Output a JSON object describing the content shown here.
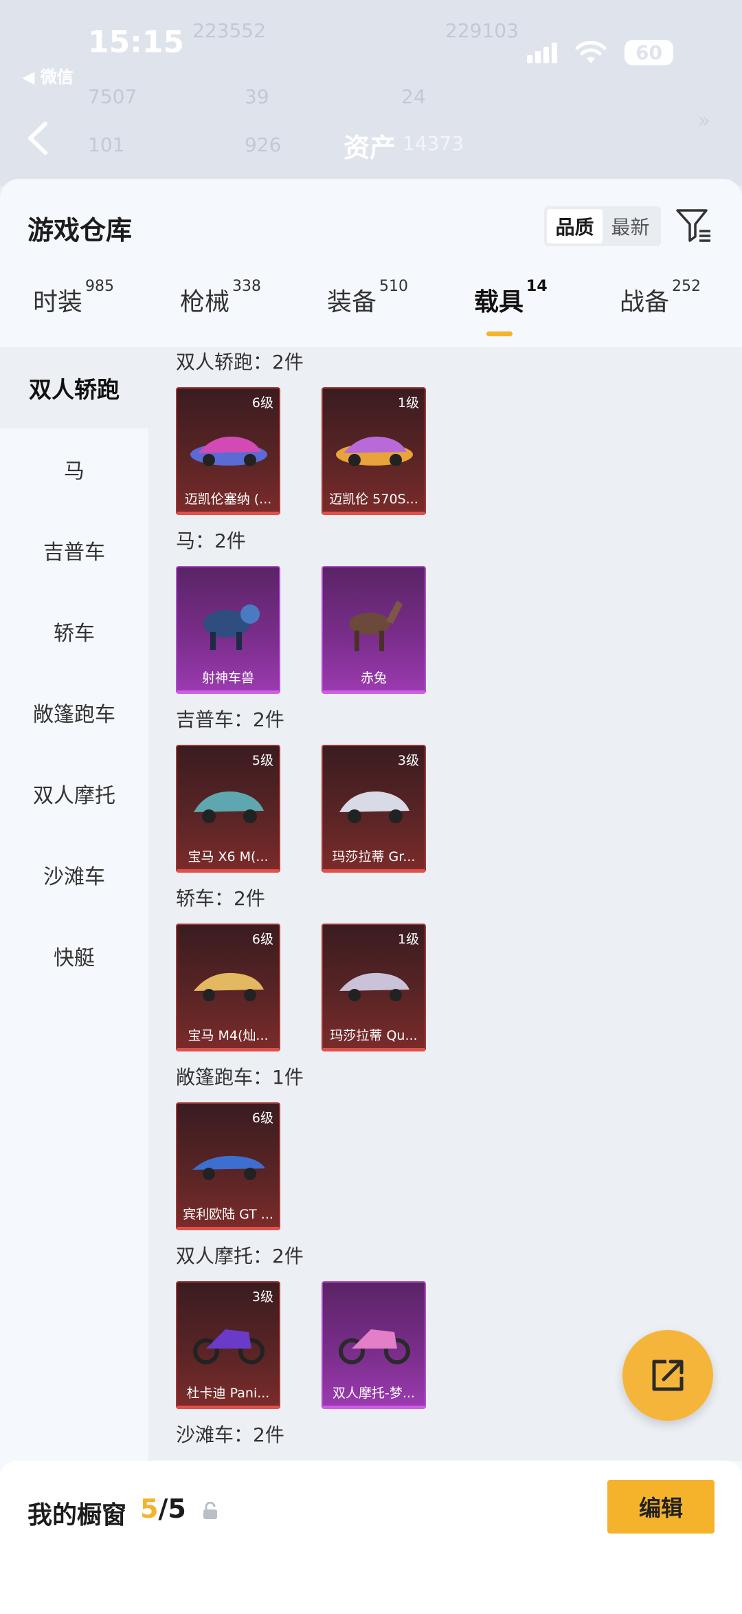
{
  "status_bar": {
    "time": "15:15",
    "battery": "60",
    "back_app": "◀ 微信"
  },
  "header_bg": {
    "row1": [
      "223552",
      "229103"
    ],
    "row2": [
      "7507",
      "39",
      "24"
    ],
    "row3": [
      "101",
      "926"
    ],
    "asset_label": "资产",
    "asset_value": "14373"
  },
  "sheet": {
    "title": "游戏仓库",
    "sort_options": [
      "品质",
      "最新"
    ],
    "tabs": [
      {
        "label": "时装",
        "count": "985"
      },
      {
        "label": "枪械",
        "count": "338"
      },
      {
        "label": "装备",
        "count": "510"
      },
      {
        "label": "载具",
        "count": "14"
      },
      {
        "label": "战备",
        "count": "252"
      }
    ],
    "categories": [
      "双人轿跑",
      "马",
      "吉普车",
      "轿车",
      "敞篷跑车",
      "双人摩托",
      "沙滩车",
      "快艇"
    ],
    "groups": [
      {
        "title": "双人轿跑：2件",
        "items": [
          {
            "level": "6级",
            "name": "迈凯伦塞纳 (...",
            "rarity": "red"
          },
          {
            "level": "1级",
            "name": "迈凯伦 570S...",
            "rarity": "red"
          }
        ]
      },
      {
        "title": "马：2件",
        "items": [
          {
            "level": "",
            "name": "射神车兽",
            "rarity": "purple"
          },
          {
            "level": "",
            "name": "赤兔",
            "rarity": "purple"
          }
        ]
      },
      {
        "title": "吉普车：2件",
        "items": [
          {
            "level": "5级",
            "name": "宝马 X6 M(...",
            "rarity": "red"
          },
          {
            "level": "3级",
            "name": "玛莎拉蒂 Gr...",
            "rarity": "red"
          }
        ]
      },
      {
        "title": "轿车：2件",
        "items": [
          {
            "level": "6级",
            "name": "宝马 M4(灿...",
            "rarity": "red"
          },
          {
            "level": "1级",
            "name": "玛莎拉蒂 Qu...",
            "rarity": "red"
          }
        ]
      },
      {
        "title": "敞篷跑车：1件",
        "items": [
          {
            "level": "6级",
            "name": "宾利欧陆 GT ...",
            "rarity": "red"
          }
        ]
      },
      {
        "title": "双人摩托：2件",
        "items": [
          {
            "level": "3级",
            "name": "杜卡迪 Pani...",
            "rarity": "red"
          },
          {
            "level": "",
            "name": "双人摩托-梦...",
            "rarity": "purple"
          }
        ]
      },
      {
        "title": "沙滩车：2件",
        "items": []
      }
    ]
  },
  "showcase": {
    "label": "我的橱窗",
    "current": "5",
    "total": "/5",
    "edit_label": "编辑"
  },
  "colors": {
    "accent": "#f5b22b",
    "red_rarity": "#e0514a",
    "purple_rarity": "#cf5de8"
  }
}
